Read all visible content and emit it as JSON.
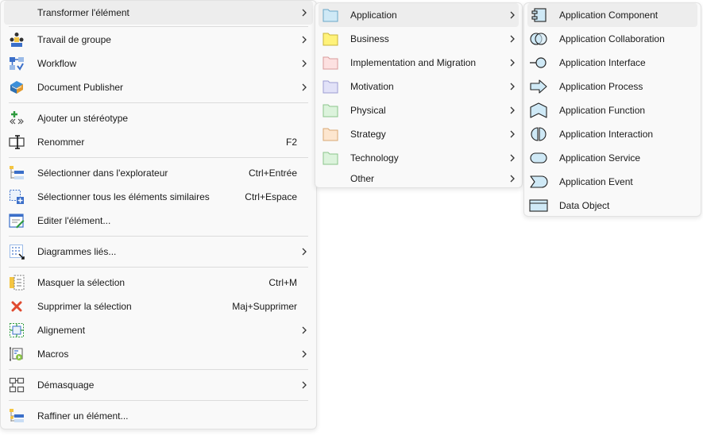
{
  "menu_main": {
    "items": [
      {
        "label": "Transformer l'élément",
        "shortcut": "",
        "icon": "none"
      },
      {
        "label": "Travail de groupe",
        "shortcut": "",
        "icon": "group-work-icon"
      },
      {
        "label": "Workflow",
        "shortcut": "",
        "icon": "workflow-icon"
      },
      {
        "label": "Document Publisher",
        "shortcut": "",
        "icon": "document-publisher-icon"
      },
      {
        "label": "Ajouter un stéréotype",
        "shortcut": "",
        "icon": "add-stereotype-icon"
      },
      {
        "label": "Renommer",
        "shortcut": "F2",
        "icon": "rename-icon"
      },
      {
        "label": "Sélectionner dans l'explorateur",
        "shortcut": "Ctrl+Entrée",
        "icon": "select-in-explorer-icon"
      },
      {
        "label": "Sélectionner tous les éléments similaires",
        "shortcut": "Ctrl+Espace",
        "icon": "select-similar-icon"
      },
      {
        "label": "Editer l'élément...",
        "shortcut": "",
        "icon": "edit-element-icon"
      },
      {
        "label": "Diagrammes liés...",
        "shortcut": "",
        "icon": "linked-diagrams-icon"
      },
      {
        "label": "Masquer la sélection",
        "shortcut": "Ctrl+M",
        "icon": "hide-selection-icon"
      },
      {
        "label": "Supprimer la sélection",
        "shortcut": "Maj+Supprimer",
        "icon": "delete-icon"
      },
      {
        "label": "Alignement",
        "shortcut": "",
        "icon": "alignment-icon"
      },
      {
        "label": "Macros",
        "shortcut": "",
        "icon": "macros-icon"
      },
      {
        "label": "Démasquage",
        "shortcut": "",
        "icon": "unmask-icon"
      },
      {
        "label": "Raffiner un élément...",
        "shortcut": "",
        "icon": "refine-element-icon"
      }
    ]
  },
  "menu_layers": {
    "items": [
      {
        "label": "Application",
        "folder_color": "#cfe9f6"
      },
      {
        "label": "Business",
        "folder_color": "#fff27a"
      },
      {
        "label": "Implementation and Migration",
        "folder_color": "#fde1e1"
      },
      {
        "label": "Motivation",
        "folder_color": "#e2e2f8"
      },
      {
        "label": "Physical",
        "folder_color": "#dcf3dc"
      },
      {
        "label": "Strategy",
        "folder_color": "#fde6cf"
      },
      {
        "label": "Technology",
        "folder_color": "#dcf3dc"
      },
      {
        "label": "Other",
        "folder_color": ""
      }
    ]
  },
  "menu_application": {
    "items": [
      {
        "label": "Application Component",
        "icon": "application-component-icon"
      },
      {
        "label": "Application Collaboration",
        "icon": "application-collaboration-icon"
      },
      {
        "label": "Application Interface",
        "icon": "application-interface-icon"
      },
      {
        "label": "Application Process",
        "icon": "application-process-icon"
      },
      {
        "label": "Application Function",
        "icon": "application-function-icon"
      },
      {
        "label": "Application Interaction",
        "icon": "application-interaction-icon"
      },
      {
        "label": "Application Service",
        "icon": "application-service-icon"
      },
      {
        "label": "Application Event",
        "icon": "application-event-icon"
      },
      {
        "label": "Data Object",
        "icon": "data-object-icon"
      }
    ]
  },
  "colors": {
    "menu_bg": "#f9f9f9",
    "highlight": "#ededed",
    "archimate_application": "#cfe9f6"
  }
}
